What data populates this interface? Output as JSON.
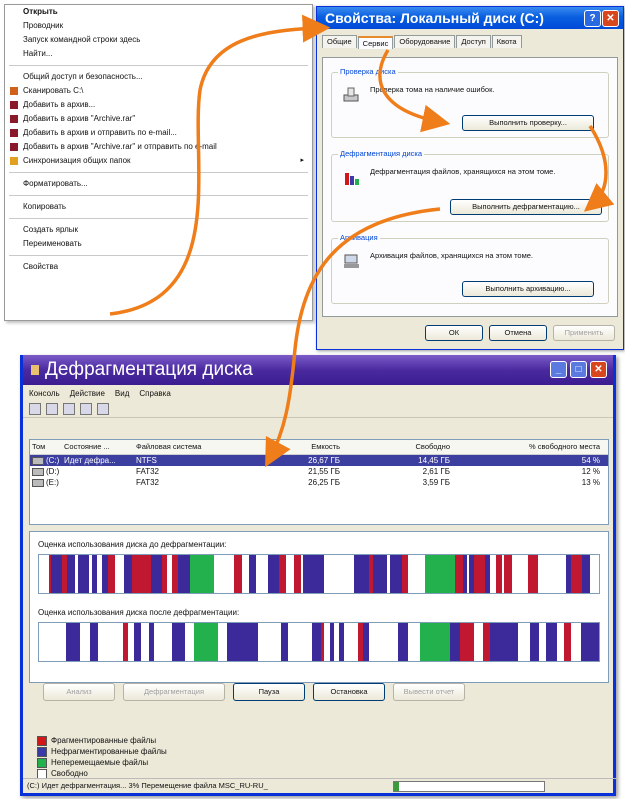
{
  "context_menu": {
    "items": [
      {
        "label": "Открыть",
        "bold": true
      },
      {
        "label": "Проводник"
      },
      {
        "label": "Запуск командной строки здесь"
      },
      {
        "label": "Найти..."
      },
      {
        "sep": true
      },
      {
        "label": "Общий доступ и безопасность..."
      },
      {
        "label": "Сканировать C:\\",
        "icon": "scan-icon",
        "icolor": "#d0601a"
      },
      {
        "label": "Добавить в архив...",
        "icon": "archive-icon",
        "icolor": "#8a1a2a"
      },
      {
        "label": "Добавить в архив \"Archive.rar\"",
        "icon": "archive-icon",
        "icolor": "#8a1a2a"
      },
      {
        "label": "Добавить в архив и отправить по e-mail...",
        "icon": "archive-icon",
        "icolor": "#8a1a2a"
      },
      {
        "label": "Добавить в архив \"Archive.rar\" и отправить по e-mail",
        "icon": "archive-icon",
        "icolor": "#8a1a2a"
      },
      {
        "label": "Синхронизация общих папок",
        "icon": "sync-icon",
        "icolor": "#e0a020",
        "submenu": true
      },
      {
        "sep": true
      },
      {
        "label": "Форматировать..."
      },
      {
        "sep": true
      },
      {
        "label": "Копировать"
      },
      {
        "sep": true
      },
      {
        "label": "Создать ярлык"
      },
      {
        "label": "Переименовать"
      },
      {
        "sep": true
      },
      {
        "label": "Свойства"
      }
    ]
  },
  "properties": {
    "title": "Свойства: Локальный диск (C:)",
    "tabs": [
      "Общие",
      "Сервис",
      "Оборудование",
      "Доступ",
      "Квота"
    ],
    "active_tab": 1,
    "check": {
      "legend": "Проверка диска",
      "desc": "Проверка тома на наличие ошибок.",
      "button": "Выполнить проверку..."
    },
    "defrag": {
      "legend": "Дефрагментация диска",
      "desc": "Дефрагментация файлов, хранящихся на этом томе.",
      "button": "Выполнить дефрагментацию..."
    },
    "backup": {
      "legend": "Архивация",
      "desc": "Архивация файлов, хранящихся на этом томе.",
      "button": "Выполнить архивацию..."
    },
    "ok": "ОК",
    "cancel": "Отмена",
    "apply": "Применить"
  },
  "defrag": {
    "title": "Дефрагментация диска",
    "menu": [
      "Консоль",
      "Действие",
      "Вид",
      "Справка"
    ],
    "columns": [
      "Том",
      "Состояние ...",
      "Файловая система",
      "Емкость",
      "Свободно",
      "% свободного места"
    ],
    "rows": [
      {
        "vol": "(C:)",
        "state": "Идет дефра...",
        "fs": "NTFS",
        "cap": "26,67 ГБ",
        "free": "14,45 ГБ",
        "pct": "54 %",
        "selected": true
      },
      {
        "vol": "(D:)",
        "state": "",
        "fs": "FAT32",
        "cap": "21,55 ГБ",
        "free": "2,61 ГБ",
        "pct": "12 %"
      },
      {
        "vol": "(E:)",
        "state": "",
        "fs": "FAT32",
        "cap": "26,25 ГБ",
        "free": "3,59 ГБ",
        "pct": "13 %"
      }
    ],
    "before_label": "Оценка использования диска до дефрагментации:",
    "after_label": "Оценка использования диска после дефрагментации:",
    "buttons": [
      {
        "label": "Анализ",
        "disabled": true
      },
      {
        "label": "Дефрагментация",
        "disabled": true
      },
      {
        "label": "Пауза",
        "disabled": false
      },
      {
        "label": "Остановка",
        "disabled": false
      },
      {
        "label": "Вывести отчет",
        "disabled": true
      }
    ],
    "legend": [
      {
        "label": "Фрагментированные файлы",
        "color": "#d01818"
      },
      {
        "label": "Нефрагментированные файлы",
        "color": "#3a3aa8"
      },
      {
        "label": "Неперемещаемые файлы",
        "color": "#22b14c"
      },
      {
        "label": "Свободно",
        "color": "#ffffff"
      }
    ],
    "status": "(C:) Идет дефрагментация... 3% Перемещение файла MSC_RU-RU_",
    "progress": 0.03,
    "colors": {
      "frag": "#c01830",
      "contig": "#3c2a9a",
      "unmovable": "#22b14c",
      "free": "#ffffff",
      "title": "#4b2aa0"
    }
  }
}
